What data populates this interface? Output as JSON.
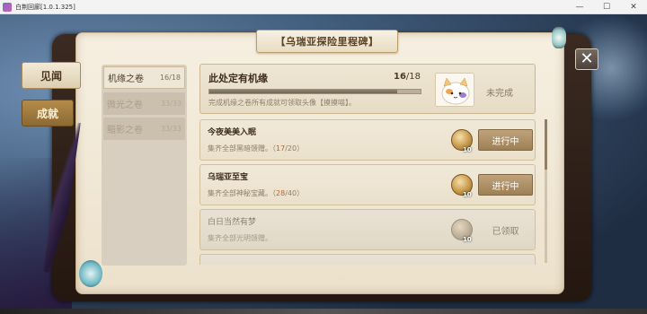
{
  "window": {
    "title": "白荆回廊[1.0.1.325]",
    "minimize": "—",
    "maximize": "☐",
    "close": "✕"
  },
  "banner": {
    "title": "【乌瑞亚探险里程碑】"
  },
  "side_tabs": [
    {
      "label": "见闻"
    },
    {
      "label": "成就"
    }
  ],
  "close_button": {
    "label": "✕"
  },
  "categories": [
    {
      "name": "机缘之卷",
      "count": "16/18"
    },
    {
      "name": "微光之卷",
      "count": "33/33"
    },
    {
      "name": "黯影之卷",
      "count": "33/33"
    }
  ],
  "summary": {
    "title": "此处定有机缘",
    "count_current": "16",
    "count_total": "/18",
    "progress": 0.889,
    "description": "完成机缘之卷所有成就可领取头像【摸摸喵】。",
    "status": "未完成"
  },
  "achievements": [
    {
      "title": "今夜美美入眠",
      "desc_prefix": "集齐全部黑暗馈赠。（",
      "progress": "17",
      "desc_suffix": "/20）",
      "reward_qty": "10",
      "button": "进行中"
    },
    {
      "title": "乌瑞亚至宝",
      "desc_prefix": "集齐全部神秘宝藏。（",
      "progress": "28",
      "desc_suffix": "/40）",
      "reward_qty": "10",
      "button": "进行中"
    },
    {
      "title": "白日当然有梦",
      "desc_prefix": "集齐全部光明馈赠。",
      "progress": "",
      "desc_suffix": "",
      "reward_qty": "10",
      "button": "已领取"
    }
  ],
  "colors": {
    "accent": "#9e8057",
    "page": "#f1e9d8",
    "highlight": "#b4682e"
  }
}
